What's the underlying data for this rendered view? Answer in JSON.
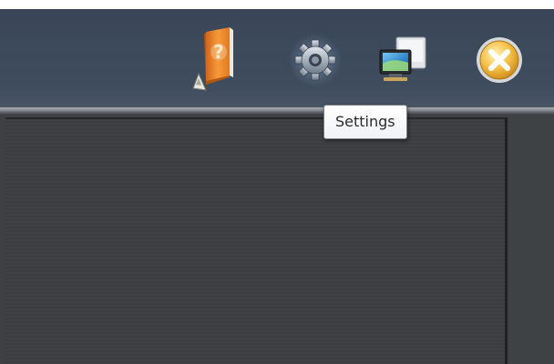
{
  "toolbar": {
    "buttons": [
      {
        "name": "help",
        "icon": "help-book-icon",
        "color": "#f28c28"
      },
      {
        "name": "settings",
        "icon": "gear-icon",
        "color": "#9aa6b4"
      },
      {
        "name": "display",
        "icon": "monitor-icon",
        "color": "#4aa3d8"
      },
      {
        "name": "close",
        "icon": "close-circle-icon",
        "color": "#f2b43c"
      }
    ]
  },
  "tooltip": {
    "text": "Settings"
  },
  "colors": {
    "toolbar_background": "#3c4a5c",
    "content_background": "#3e4043",
    "tooltip_background": "#f5f6f8"
  }
}
